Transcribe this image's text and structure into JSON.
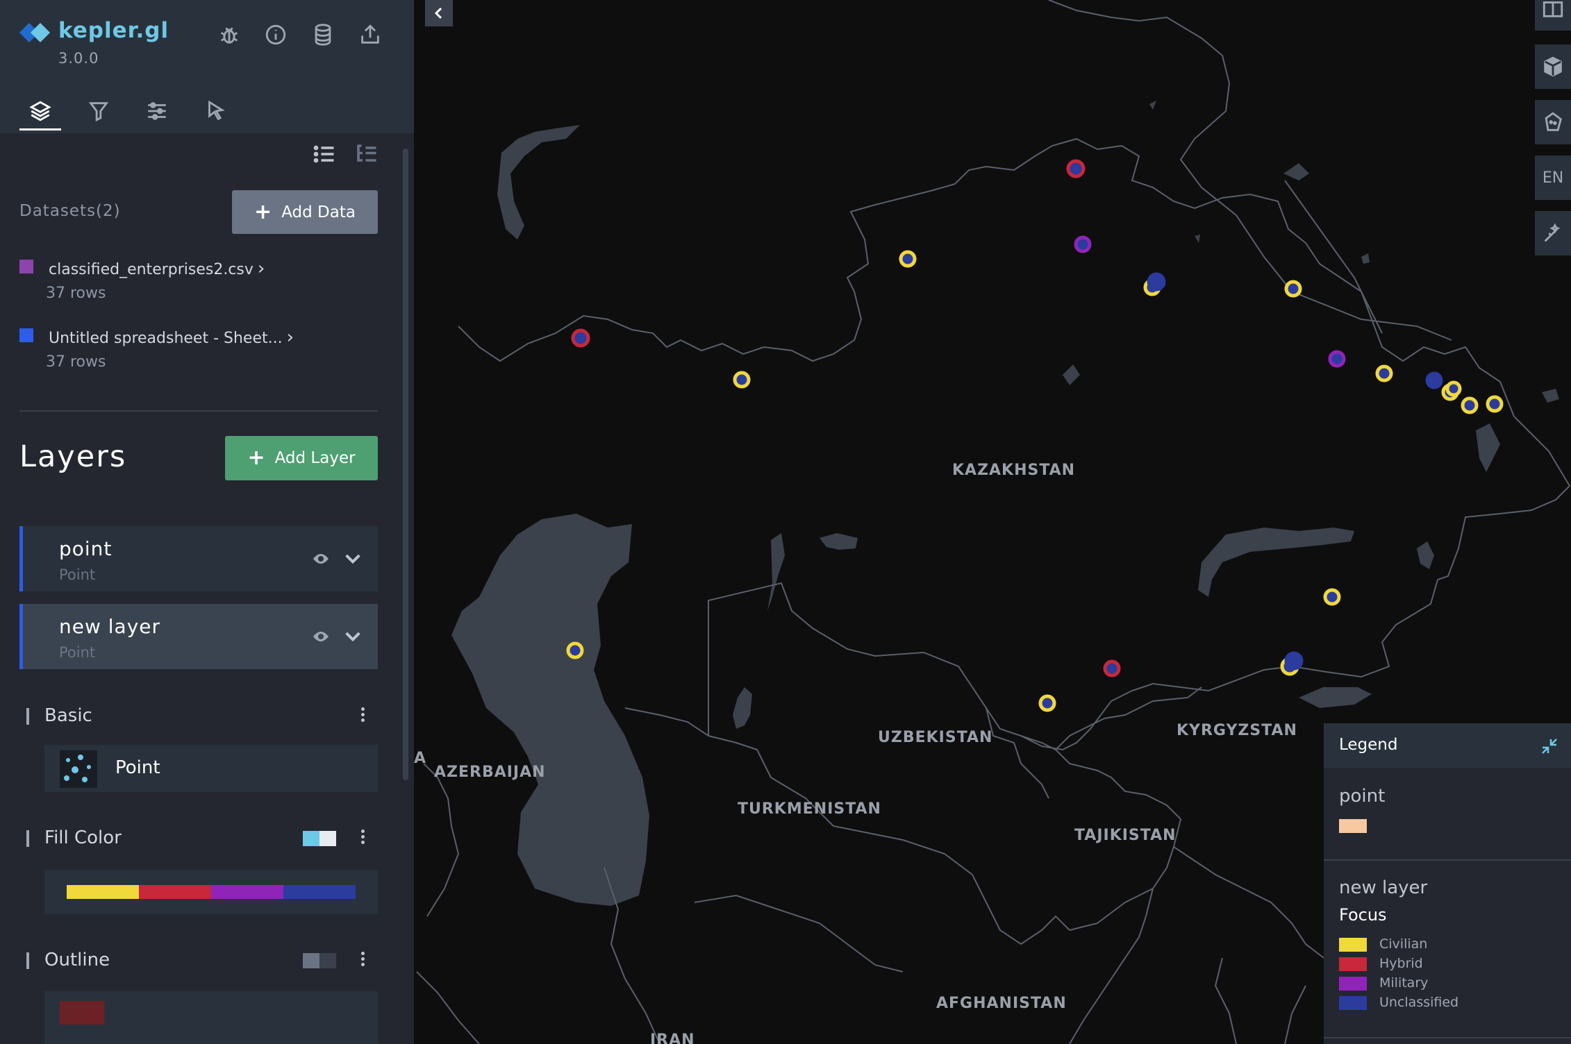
{
  "app": {
    "name": "kepler.gl",
    "version": "3.0.0"
  },
  "header": {
    "icons": [
      "bug-icon",
      "info-icon",
      "database-icon",
      "share-icon"
    ]
  },
  "tabs": [
    {
      "id": "layers",
      "icon": "layers-icon",
      "active": true
    },
    {
      "id": "filters",
      "icon": "filter-icon",
      "active": false
    },
    {
      "id": "settings",
      "icon": "sliders-icon",
      "active": false
    },
    {
      "id": "interactions",
      "icon": "cursor-icon",
      "active": false
    }
  ],
  "datasets": {
    "title": "Datasets(2)",
    "add_label": "Add Data",
    "items": [
      {
        "name": "classified_enterprises2.csv",
        "rows": "37 rows",
        "color": "#8e44ad"
      },
      {
        "name": "Untitled spreadsheet - Sheet...",
        "rows": "37 rows",
        "color": "#2e5de6"
      }
    ]
  },
  "layers": {
    "title": "Layers",
    "add_label": "Add Layer",
    "items": [
      {
        "name": "point",
        "type": "Point"
      },
      {
        "name": "new layer",
        "type": "Point"
      }
    ]
  },
  "config": {
    "basic_title": "Basic",
    "layer_type_label": "Point",
    "fill_title": "Fill Color",
    "outline_title": "Outline",
    "palette": [
      "#f0d93a",
      "#c9273a",
      "#9024b8",
      "#2b3b9e"
    ]
  },
  "map": {
    "labels": [
      {
        "text": "KAZAKHSTAN"
      },
      {
        "text": "UZBEKISTAN"
      },
      {
        "text": "KYRGYZSTAN"
      },
      {
        "text": "TURKMENISTAN"
      },
      {
        "text": "TAJIKISTAN"
      },
      {
        "text": "AZERBAIJAN"
      },
      {
        "text": "AFGHANISTAN"
      },
      {
        "text": "IRAN"
      },
      {
        "text": "A"
      }
    ],
    "controls": {
      "lang": "EN"
    },
    "point_categories": [
      "Civilian",
      "Hybrid",
      "Military",
      "Unclassified"
    ]
  },
  "legend": {
    "title": "Legend",
    "layer1": {
      "name": "point",
      "color": "#f7c9a0"
    },
    "layer2": {
      "name": "new layer",
      "field": "Focus",
      "items": [
        {
          "label": "Civilian",
          "color": "#f0d93a"
        },
        {
          "label": "Hybrid",
          "color": "#c9273a"
        },
        {
          "label": "Military",
          "color": "#9024b8"
        },
        {
          "label": "Unclassified",
          "color": "#2b3b9e"
        }
      ]
    }
  }
}
